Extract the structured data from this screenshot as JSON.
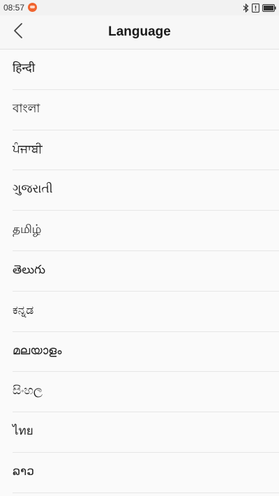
{
  "status_bar": {
    "time": "08:57",
    "icons": [
      "notification-icon",
      "bluetooth-icon",
      "alert-icon",
      "battery-icon"
    ]
  },
  "header": {
    "back_icon": "chevron-left-icon",
    "title": "Language"
  },
  "languages": [
    {
      "label": "हिन्दी"
    },
    {
      "label": "বাংলা"
    },
    {
      "label": "ਪੰਜਾਬੀ"
    },
    {
      "label": "ગુજરાતી"
    },
    {
      "label": "தமிழ்"
    },
    {
      "label": "తెలుగు"
    },
    {
      "label": "ಕನ್ನಡ"
    },
    {
      "label": "മലയാളം"
    },
    {
      "label": "සිංහල"
    },
    {
      "label": "ไทย"
    },
    {
      "label": "ລາວ"
    }
  ],
  "colors": {
    "background": "#fafafa",
    "header_bg": "#f7f7f7",
    "divider": "#e6e6e6",
    "notification": "#f0642f"
  }
}
